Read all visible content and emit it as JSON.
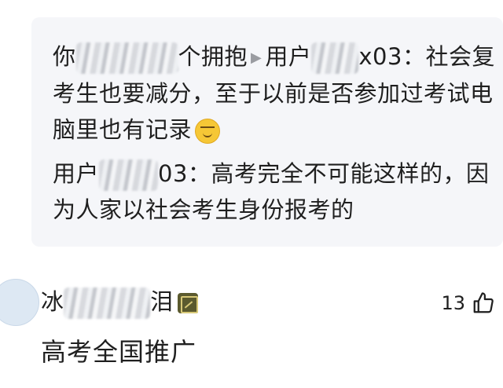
{
  "reply1": {
    "user_start": "你",
    "user_end": "个拥抱",
    "reply_to_end": "x03",
    "colon": "：",
    "text_line1": "社会复",
    "text_line2": "考生也要减分，至于以前是否参加过考试电",
    "text_line3": "脑里也有记录"
  },
  "reply2": {
    "user_start": "用户",
    "user_end": "03",
    "colon": "：",
    "text_line1": "高考完全不可能这样的，因",
    "text_line2": "为人家以社会考生身份报考的"
  },
  "reply1_target_prefix": "用户",
  "comment": {
    "user_start": "冰",
    "user_end": "泪",
    "likes": "13",
    "text": "高考全国推广"
  },
  "icons": {
    "reply_arrow": "play-arrow-icon",
    "emoji": "grin-emoji-icon",
    "badge": "level-badge-icon",
    "like": "thumbs-up-icon"
  }
}
